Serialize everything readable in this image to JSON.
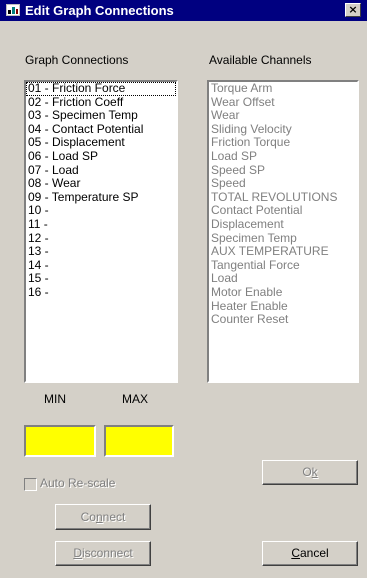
{
  "window": {
    "title": "Edit Graph Connections",
    "close_glyph": "×",
    "icon": "app-icon"
  },
  "labels": {
    "graph_connections": "Graph Connections",
    "available_channels": "Available Channels",
    "min": "MIN",
    "max": "MAX",
    "auto_rescale": "Auto Re-scale"
  },
  "graph_connections": [
    "01 - Friction Force",
    "02 - Friction Coeff",
    "03 - Specimen Temp",
    "04 - Contact Potential",
    "05 - Displacement",
    "06 - Load SP",
    "07 - Load",
    "08 - Wear",
    "09 - Temperature SP",
    "10 -",
    "11 -",
    "12 -",
    "13 -",
    "14 -",
    "15 -",
    "16 -"
  ],
  "available_channels": [
    "Torque Arm",
    "Wear Offset",
    "Wear",
    "Sliding Velocity",
    "Friction Torque",
    "Load SP",
    "Speed SP",
    "Speed",
    "TOTAL REVOLUTIONS",
    "Contact Potential",
    "Displacement",
    "Specimen Temp",
    "AUX TEMPERATURE",
    "Tangential Force",
    "Load",
    "Motor Enable",
    "Heater Enable",
    "Counter Reset"
  ],
  "buttons": {
    "ok": {
      "prefix": "O",
      "accel": "k",
      "suffix": ""
    },
    "connect": {
      "prefix": "Co",
      "accel": "n",
      "suffix": "nect"
    },
    "disconnect": {
      "prefix": "",
      "accel": "D",
      "suffix": "isconnect"
    },
    "cancel": {
      "prefix": "",
      "accel": "C",
      "suffix": "ancel"
    }
  },
  "colors": {
    "titlebar": "#000080",
    "minmax_fields": "#ffff00",
    "dialog": "#d4d0c8"
  }
}
